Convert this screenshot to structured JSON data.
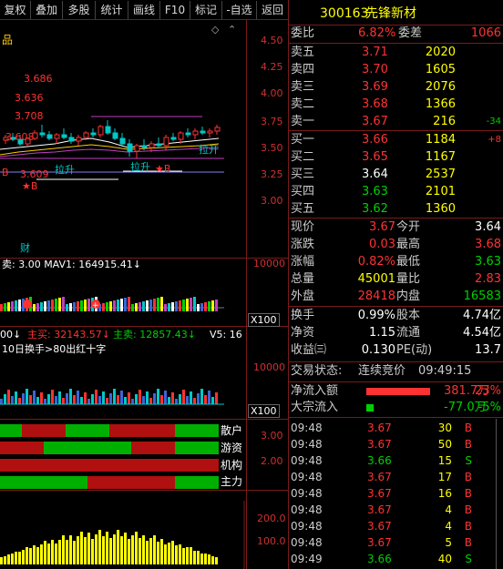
{
  "toolbar": {
    "b1": "复权",
    "b2": "叠加",
    "b3": "多股",
    "b4": "统计",
    "b5": "画线",
    "b6": "F10",
    "b7": "标记",
    "b8": "-自选",
    "b9": "返回"
  },
  "chart": {
    "product_char": "品",
    "price_labels": {
      "p1": "3.686",
      "p2": "3.636",
      "p3": "3.708",
      "p4": "3.608",
      "p5": "3.609"
    },
    "annotations": {
      "lasheng1": "拉升",
      "lasheng2": "拉升",
      "lakai": "拉开",
      "bmark1": "★B",
      "bmark2": "★B",
      "bmark3": "B",
      "cai": "财"
    },
    "y_axis": [
      "4.50",
      "4.25",
      "4.00",
      "3.75",
      "3.50",
      "3.25",
      "3.00"
    ],
    "vol_panel": {
      "label": "卖: 3.00 MAV1: 164915.41↓",
      "axis": "10000",
      "unit": "X100"
    },
    "flow_panel": {
      "l1": "00↓",
      "l2": "主买: 32143.57↓",
      "l3": "主卖: 12857.43↓",
      "l4": "V5: 16",
      "note": "10日换手>80出红十字",
      "axis": "10000",
      "unit": "X100"
    },
    "players": {
      "axis1": "3.00",
      "axis2": "2.00",
      "labels": [
        "散户",
        "游资",
        "机构",
        "主力"
      ]
    },
    "bottom_panel": {
      "axis1": "200.0",
      "axis2": "100.0"
    }
  },
  "quote": {
    "code": "300163",
    "name": "先锋新材",
    "weibi_label": "委比",
    "weibi_val": "6.82%",
    "weicha_label": "委差",
    "weicha_val": "1066",
    "sells": [
      {
        "label": "卖五",
        "price": "3.71",
        "vol": "2020",
        "chg": ""
      },
      {
        "label": "卖四",
        "price": "3.70",
        "vol": "1605",
        "chg": ""
      },
      {
        "label": "卖三",
        "price": "3.69",
        "vol": "2076",
        "chg": ""
      },
      {
        "label": "卖二",
        "price": "3.68",
        "vol": "1366",
        "chg": ""
      },
      {
        "label": "卖一",
        "price": "3.67",
        "vol": "216",
        "chg": "-34"
      }
    ],
    "buys": [
      {
        "label": "买一",
        "price": "3.66",
        "vol": "1184",
        "chg": "+8"
      },
      {
        "label": "买二",
        "price": "3.65",
        "vol": "1167",
        "chg": ""
      },
      {
        "label": "买三",
        "price": "3.64",
        "vol": "2537",
        "chg": ""
      },
      {
        "label": "买四",
        "price": "3.63",
        "vol": "2101",
        "chg": ""
      },
      {
        "label": "买五",
        "price": "3.62",
        "vol": "1360",
        "chg": ""
      }
    ],
    "stats": [
      {
        "l1": "现价",
        "v1": "3.67",
        "l2": "今开",
        "v2": "3.64"
      },
      {
        "l1": "涨跌",
        "v1": "0.03",
        "l2": "最高",
        "v2": "3.68"
      },
      {
        "l1": "涨幅",
        "v1": "0.82%",
        "l2": "最低",
        "v2": "3.63"
      },
      {
        "l1": "总量",
        "v1": "45001",
        "l2": "量比",
        "v2": "2.83"
      },
      {
        "l1": "外盘",
        "v1": "28418",
        "l2": "内盘",
        "v2": "16583"
      }
    ],
    "stats2": [
      {
        "l1": "换手",
        "v1": "0.99%",
        "l2": "股本",
        "v2": "4.74亿"
      },
      {
        "l1": "净资",
        "v1": "1.15",
        "l2": "流通",
        "v2": "4.54亿"
      },
      {
        "l1": "收益㈢",
        "v1": "0.130",
        "l2": "PE(动)",
        "v2": "13.7"
      }
    ],
    "status_label": "交易状态:",
    "status_val": "连续竞价",
    "status_time": "09:49:15",
    "flow1_label": "净流入额",
    "flow1_val": "381.7万",
    "flow1_pct": "23%",
    "flow2_label": "大宗流入",
    "flow2_val": "-77.0万",
    "flow2_pct": "-5%",
    "ticks": [
      {
        "t": "09:48",
        "p": "3.67",
        "v": "30",
        "d": "B"
      },
      {
        "t": "09:48",
        "p": "3.67",
        "v": "50",
        "d": "B"
      },
      {
        "t": "09:48",
        "p": "3.66",
        "v": "15",
        "d": "S"
      },
      {
        "t": "09:48",
        "p": "3.67",
        "v": "17",
        "d": "B"
      },
      {
        "t": "09:48",
        "p": "3.67",
        "v": "16",
        "d": "B"
      },
      {
        "t": "09:48",
        "p": "3.67",
        "v": "4",
        "d": "B"
      },
      {
        "t": "09:48",
        "p": "3.67",
        "v": "4",
        "d": "B"
      },
      {
        "t": "09:48",
        "p": "3.67",
        "v": "5",
        "d": "B"
      },
      {
        "t": "09:49",
        "p": "3.66",
        "v": "40",
        "d": "S"
      }
    ]
  },
  "colors": {
    "red": "#ff3232",
    "green": "#00d000",
    "yellow": "#ffff00",
    "white": "#ffffff",
    "cyan": "#00c8c8",
    "gold": "#ffcc00",
    "blue": "#3a66d8"
  }
}
